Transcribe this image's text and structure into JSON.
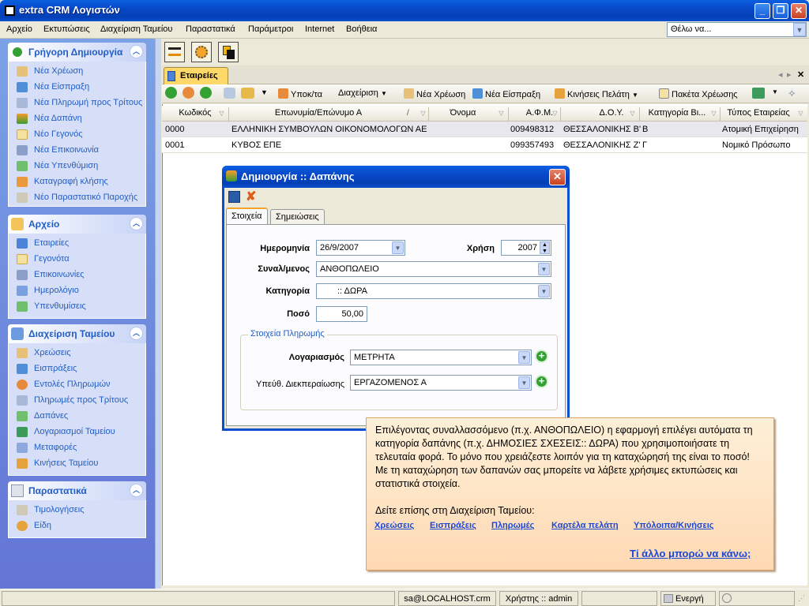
{
  "window": {
    "title": "extra CRM Λογιστών",
    "min": "_",
    "max": "❐",
    "close": "✕"
  },
  "menu": [
    "Αρχείο",
    "Εκτυπώσεις",
    "Διαχείριση Ταμείου",
    "Παραστατικά",
    "Παράμετροι",
    "Internet",
    "Βοήθεια"
  ],
  "search": {
    "value": "Θέλω να..."
  },
  "sidebar": {
    "quick": {
      "title": "Γρήγορη Δημιουργία",
      "items": [
        "Νέα Χρέωση",
        "Νέα Είσπραξη",
        "Νέα Πληρωμή προς Τρίτους",
        "Νέα Δαπάνη",
        "Νέο Γεγονός",
        "Νέα Επικοινωνία",
        "Νέα Υπενθύμιση",
        "Καταγραφή κλήσης",
        "Νέο Παραστατικό Παροχής"
      ]
    },
    "archive": {
      "title": "Αρχείο",
      "items": [
        "Εταιρείες",
        "Γεγονότα",
        "Επικοινωνίες",
        "Ημερολόγιο",
        "Υπενθυμίσεις"
      ]
    },
    "cash": {
      "title": "Διαχείριση Ταμείου",
      "items": [
        "Χρεώσεις",
        "Εισπράξεις",
        "Εντολές Πληρωμών",
        "Πληρωμές προς Τρίτους",
        "Δαπάνες",
        "Λογαριασμοί Ταμείου",
        "Μεταφορές",
        "Κινήσεις Ταμείου"
      ]
    },
    "docs": {
      "title": "Παραστατικά",
      "items": [
        "Τιμολογήσεις",
        "Είδη"
      ]
    }
  },
  "tab": {
    "label": "Εταιρείες"
  },
  "toolbar2": {
    "subcat": "Υποκ/τα",
    "manage": "Διαχείριση",
    "new_charge": "Νέα Χρέωση",
    "new_receipt": "Νέα Είσπραξη",
    "client_moves": "Κινήσεις Πελάτη",
    "packages": "Πακέτα Χρέωσης"
  },
  "grid": {
    "columns": [
      "Κωδικός",
      "Επωνυμία/Επώνυμο Α",
      "Όνομα",
      "Α.Φ.Μ.",
      "Δ.Ο.Υ.",
      "Κατηγορία Βι...",
      "Τύπος Εταιρείας"
    ],
    "rows": [
      [
        "0000",
        "ΕΛΛΗΝΙΚΗ ΣΥΜΒΟΥΛΩΝ ΟΙΚΟΝΟΜΟΛΟΓΩΝ ΑΕ",
        "",
        "009498312",
        "ΘΕΣΣΑΛΟΝΙΚΗΣ Β'",
        "Β",
        "Ατομική Επιχείρηση"
      ],
      [
        "0001",
        "ΚΥΒΟΣ ΕΠΕ",
        "",
        "099357493",
        "ΘΕΣΣΑΛΟΝΙΚΗΣ Ζ'",
        "Γ",
        "Νομικό Πρόσωπο"
      ]
    ]
  },
  "dialog": {
    "title": "Δημιουργία :: Δαπάνης",
    "tabs": [
      "Στοιχεία",
      "Σημειώσεις"
    ],
    "date_label": "Ημερομηνία",
    "date_value": "26/9/2007",
    "year_label": "Χρήση",
    "year_value": "2007",
    "party_label": "Συναλ/μενος",
    "party_value": "ΑΝΘΟΠΩΛΕΙΟ",
    "category_label": "Κατηγορία",
    "category_value": ":: ΔΩΡΑ",
    "amount_label": "Ποσό",
    "amount_value": "50,00",
    "payment_group": "Στοιχεία Πληρωμής",
    "account_label": "Λογαριασμός",
    "account_value": "ΜΕΤΡΗΤΑ",
    "handler_label": "Υπεύθ. Διεκπεραίωσης",
    "handler_value": "ΕΡΓΑΖΟΜΕΝΟΣ Α"
  },
  "callout": {
    "text": "Επιλέγοντας συναλλασσόμενο (π.χ. ΑΝΘΟΠΩΛΕΙΟ) η εφαρμογή επιλέγει αυτόματα τη κατηγορία δαπάνης (π.χ. ΔΗΜΟΣΙΕΣ ΣΧΕΣΕΙΣ:: ΔΩΡΑ) που χρησιμοποιήσατε τη τελευταία φορά. Το μόνο που χρειάζεστε λοιπόν για τη καταχώρησή της είναι το ποσό! Με τη καταχώρηση των δαπανών σας μπορείτε να λάβετε χρήσιμες εκτυπώσεις και στατιστικά στοιχεία.",
    "see_also": "Δείτε επίσης στη Διαχείριση Ταμείου:",
    "links": [
      "Χρεώσεις",
      "Εισπράξεις",
      "Πληρωμές",
      "Καρτέλα πελάτη",
      "Υπόλοιπα/Κινήσεις"
    ],
    "more": "Τί άλλο μπορώ να κάνω;"
  },
  "status": {
    "server": "sa@LOCALHOST.crm",
    "user": "Χρήστης :: admin",
    "state": "Ενεργή"
  }
}
